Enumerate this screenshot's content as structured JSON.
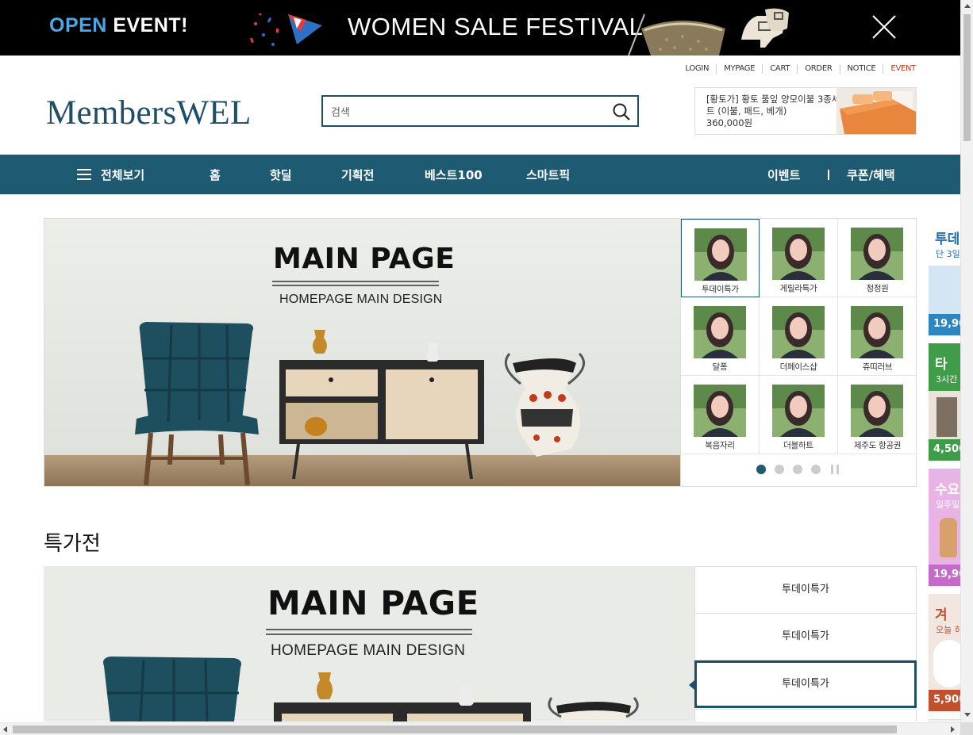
{
  "promo": {
    "open_label": "OPEN",
    "event_label": "EVENT!",
    "headline": "WOMEN SALE FESTIVAL",
    "close_icon": "close-icon"
  },
  "util_links": [
    "LOGIN",
    "MYPAGE",
    "CART",
    "ORDER",
    "NOTICE",
    "EVENT"
  ],
  "header": {
    "logo": "MembersWEL",
    "search_placeholder": "검색",
    "search_icon": "search-icon",
    "ad": {
      "title": "[황토가] 황토 풀잎 양모이불 3종세트 (이불, 패드, 베개)",
      "price": "360,000원"
    }
  },
  "nav": {
    "all_label": "전체보기",
    "items": [
      "홈",
      "핫딜",
      "기획전",
      "베스트100",
      "스마트픽"
    ],
    "right_items": [
      "이벤트",
      "쿠폰/혜택"
    ]
  },
  "hero": {
    "title": "MAIN PAGE",
    "subtitle": "HOMEPAGE MAIN DESIGN",
    "thumbs": [
      "투데이특가",
      "게릴라특가",
      "청정원",
      "달퐁",
      "더페이스샵",
      "쥬띠러브",
      "복음자리",
      "더블하트",
      "제주도 항공권"
    ],
    "active_thumb": 0,
    "dots": 4,
    "active_dot": 0
  },
  "side_ads": [
    {
      "title": "투데",
      "sub": "단 3일",
      "price": "19,90",
      "color": "#2e86c1"
    },
    {
      "title": "타",
      "sub": "3시간",
      "price": "4,500",
      "color": "#3f9d4a"
    },
    {
      "title": "수요",
      "sub": "일주일",
      "price": "19,90",
      "color": "#c36bc7"
    },
    {
      "title": "겨",
      "sub": "오늘 하",
      "price": "5,900",
      "color": "#c1502e"
    }
  ],
  "special": {
    "title": "특가전",
    "banner_title": "MAIN PAGE",
    "banner_subtitle": "HOMEPAGE MAIN DESIGN",
    "tabs": [
      "투데이특가",
      "투데이특가",
      "투데이특가"
    ],
    "active_tab": 2
  },
  "colors": {
    "brand": "#1e5a72",
    "logo": "#1e4f66",
    "promo_bg": "#000000",
    "open_blue": "#4aa8e8",
    "event_red": "#c0392b"
  }
}
